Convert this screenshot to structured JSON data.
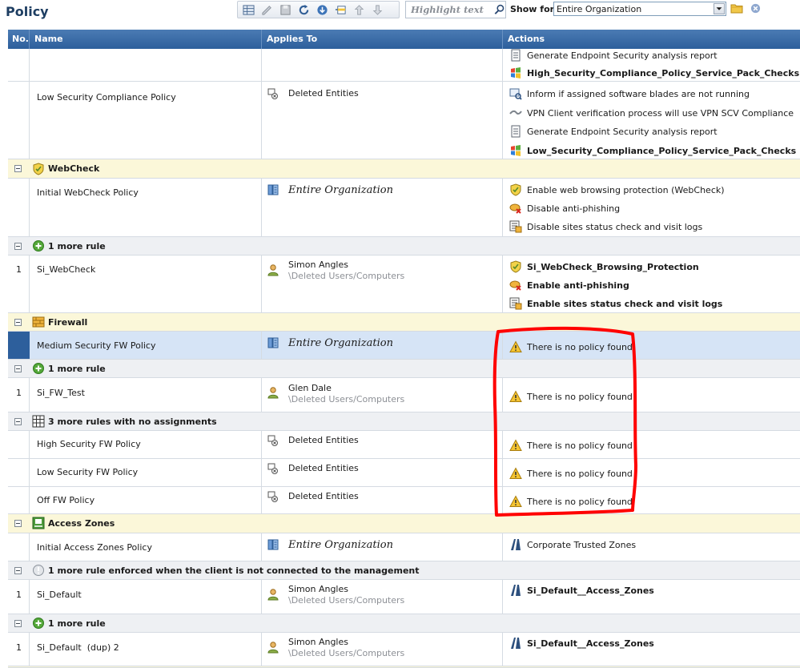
{
  "header": {
    "title": "Policy",
    "search_placeholder": "Highlight text",
    "show_for_label": "Show for:",
    "show_for_value": "Entire Organization"
  },
  "columns": {
    "no": "No.",
    "name": "Name",
    "applies_to": "Applies To",
    "actions": "Actions"
  },
  "top_row": {
    "actions": [
      "Generate Endpoint Security analysis report",
      "High_Security_Compliance_Policy_Service_Pack_Checks"
    ]
  },
  "low_compliance": {
    "name": "Low Security Compliance Policy",
    "applies": "Deleted Entities",
    "actions": [
      "Inform if assigned software blades are not running",
      "VPN Client verification process will use VPN SCV Compliance",
      "Generate Endpoint Security analysis report",
      "Low_Security_Compliance_Policy_Service_Pack_Checks"
    ]
  },
  "webcheck": {
    "group": "WebCheck",
    "policy_name": "Initial WebCheck Policy",
    "policy_applies": "Entire Organization",
    "policy_actions": [
      "Enable web browsing protection (WebCheck)",
      "Disable anti-phishing",
      "Disable sites status check and visit logs"
    ],
    "more_rule": "1 more rule",
    "rule_no": "1",
    "rule_name": "Si_WebCheck",
    "rule_user": "Simon Angles",
    "rule_path": "\\Deleted Users/Computers",
    "rule_actions": [
      "Si_WebCheck_Browsing_Protection",
      "Enable anti-phishing",
      "Enable sites status check and visit logs"
    ]
  },
  "firewall": {
    "group": "Firewall",
    "policy_name": "Medium Security FW Policy",
    "policy_applies": "Entire Organization",
    "no_policy": "There is no policy found",
    "more_rule": "1 more rule",
    "rule_no": "1",
    "rule_name": "Si_FW_Test",
    "rule_user": "Glen Dale",
    "rule_path": "\\Deleted Users/Computers",
    "unassigned": "3 more rules with no assignments",
    "unassigned_rules": [
      {
        "name": "High Security FW Policy",
        "applies": "Deleted Entities"
      },
      {
        "name": "Low Security FW Policy",
        "applies": "Deleted Entities"
      },
      {
        "name": "Off FW Policy",
        "applies": "Deleted Entities"
      }
    ]
  },
  "access_zones": {
    "group": "Access Zones",
    "policy_name": "Initial Access Zones Policy",
    "policy_applies": "Entire Organization",
    "policy_action": "Corporate Trusted Zones",
    "disconnected": "1 more rule enforced when the client is not connected to the management",
    "rule1_no": "1",
    "rule1_name": "Si_Default",
    "rule1_user": "Simon Angles",
    "rule1_path": "\\Deleted Users/Computers",
    "rule1_action": "Si_Default__Access_Zones",
    "more_rule": "1 more rule",
    "rule2_no": "1",
    "rule2_name": "Si_Default  (dup) 2",
    "rule2_user": "Simon Angles",
    "rule2_path": "\\Deleted Users/Computers",
    "rule2_action": "Si_Default__Access_Zones"
  },
  "icons": {
    "toolbar": [
      "grid-view-icon",
      "edit-icon",
      "save-icon",
      "refresh-icon",
      "install-icon",
      "add-rule-icon",
      "move-up-icon",
      "move-down-icon"
    ],
    "status": [
      "warning-icon",
      "deleted-entities-icon",
      "user-icon",
      "organization-icon",
      "shield-icon"
    ]
  },
  "colors": {
    "header": "#2d5f9c",
    "group_yellow": "#fbf7d9",
    "group_gray": "#eef0f3",
    "selected": "#d6e4f6",
    "annotation": "#ff0000"
  }
}
